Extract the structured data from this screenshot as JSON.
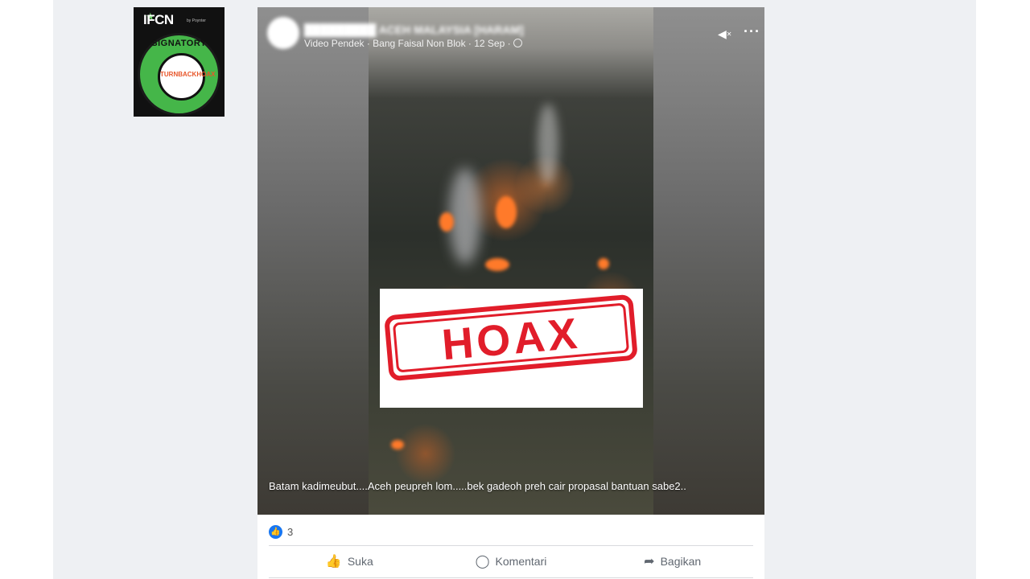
{
  "badge": {
    "brand": "IFCN",
    "sub": "by Poynter",
    "ring_text": "SIGNATORY",
    "logo_text": "TURNBACKHOAX"
  },
  "post": {
    "page_name": "█████████ ACEH MALAYSIA [HARAM]",
    "meta_text": "Video Pendek · Bang Faisal Non Blok · 12 Sep ·",
    "caption": "Batam kadimeubut....Aceh peupreh lom.....bek gadeoh preh cair propasal bantuan sabe2..",
    "overlay_stamp": "HOAX",
    "reaction_count": "3",
    "icons": {
      "mute": "mute-icon",
      "more": "more-icon",
      "like": "like-icon",
      "comment": "comment-icon",
      "share": "share-icon",
      "privacy": "globe-icon"
    }
  },
  "actions": {
    "like_label": "Suka",
    "comment_label": "Komentari",
    "share_label": "Bagikan"
  },
  "colors": {
    "stamp": "#e11d2a",
    "like_badge": "#1877f2",
    "badge_green": "#45b649"
  }
}
